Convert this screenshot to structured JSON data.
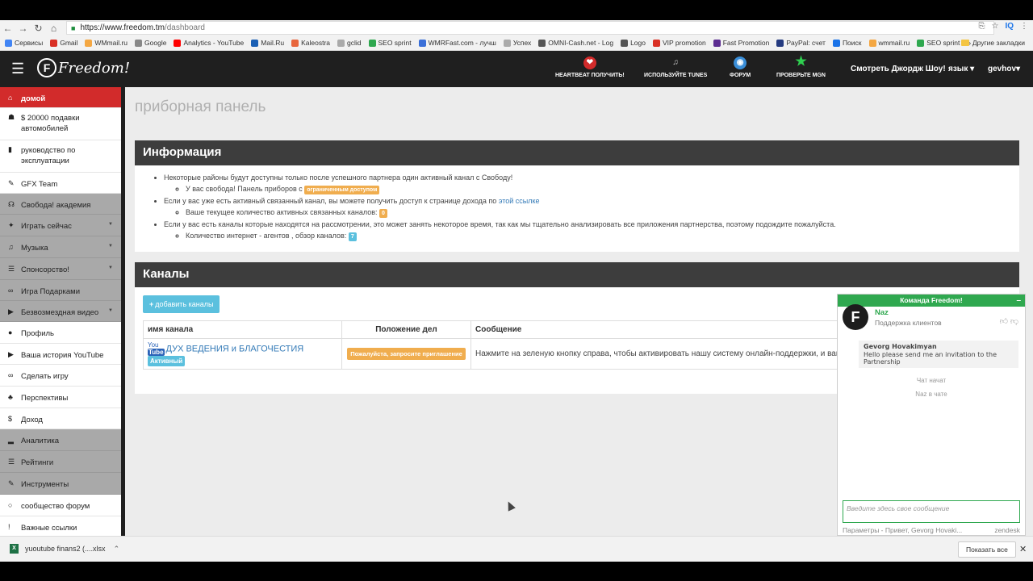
{
  "browser": {
    "url_host": "https://www.freedom.tm",
    "url_path": "/dashboard",
    "ext_label": "IQ",
    "bookmarks": [
      {
        "label": "Сервисы",
        "color": "#4285f4"
      },
      {
        "label": "Gmail",
        "color": "#d93025"
      },
      {
        "label": "WMmail.ru",
        "color": "#f4a742"
      },
      {
        "label": "Google",
        "color": "#888888"
      },
      {
        "label": "Analytics - YouTube",
        "color": "#ff0000"
      },
      {
        "label": "Mail.Ru",
        "color": "#1a5fb4"
      },
      {
        "label": "Kaleostra",
        "color": "#e8663d"
      },
      {
        "label": "gclid",
        "color": "#aaaaaa"
      },
      {
        "label": "SEO sprint",
        "color": "#2fa84f"
      },
      {
        "label": "WMRFast.com - лучш",
        "color": "#3a6fd8"
      },
      {
        "label": "Успех",
        "color": "#aaaaaa"
      },
      {
        "label": "OMNI-Cash.net - Log",
        "color": "#555555"
      },
      {
        "label": "Logo",
        "color": "#555555"
      },
      {
        "label": "VIP promotion",
        "color": "#d93025"
      },
      {
        "label": "Fast Promotion",
        "color": "#5c2d91"
      },
      {
        "label": "PayPal: счет",
        "color": "#253b80"
      },
      {
        "label": "Поиск",
        "color": "#1a73e8"
      },
      {
        "label": "wmmail.ru",
        "color": "#f4a742"
      },
      {
        "label": "SEO sprint",
        "color": "#2fa84f"
      }
    ],
    "bookmarks_more": "»",
    "other_bookmarks": "Другие закладки"
  },
  "header": {
    "logo_letter": "F",
    "logo_text": "Freedom!",
    "items": [
      {
        "label": "HEARTBEAT ПОЛУЧИТЬ!",
        "icon": "heart-icon",
        "color": "#d22b2b",
        "glyph": "❤"
      },
      {
        "label": "ИСПОЛЬЗУЙТЕ TUNES",
        "icon": "tunes-icon",
        "color": "#1f1f1f",
        "glyph": "♫"
      },
      {
        "label": "ФОРУМ",
        "icon": "forum-icon",
        "color": "#3a8ed8",
        "glyph": "◉"
      },
      {
        "label": "ПРОВЕРЬТЕ MGN",
        "icon": "star-icon",
        "color": "#1f1f1f",
        "glyph": "★"
      }
    ],
    "watch": "Смотреть Джордж Шоу!",
    "language": "язык",
    "user": "gevhov"
  },
  "sidebar": {
    "items": [
      {
        "label": "домой",
        "icon": "home-icon",
        "glyph": "⌂",
        "style": "active",
        "h": 26,
        "arrow": false
      },
      {
        "label": "$ 20000 подавки автомобилей",
        "icon": "car-icon",
        "glyph": "☗",
        "style": "white",
        "h": 40,
        "arrow": false
      },
      {
        "label": "руководство по эксплуатации",
        "icon": "book-icon",
        "glyph": "▮",
        "style": "white",
        "h": 40,
        "arrow": false
      },
      {
        "label": "GFX Team",
        "icon": "brush-icon",
        "glyph": "✎",
        "style": "white",
        "h": 26,
        "arrow": false
      },
      {
        "label": "Свобода! академия",
        "icon": "academy-icon",
        "glyph": "☊",
        "style": "gray",
        "h": 26,
        "arrow": false
      },
      {
        "label": "Играть сейчас",
        "icon": "gamepad-icon",
        "glyph": "✦",
        "style": "gray",
        "h": 27,
        "arrow": true
      },
      {
        "label": "Музыка",
        "icon": "music-icon",
        "glyph": "♫",
        "style": "gray",
        "h": 27,
        "arrow": true
      },
      {
        "label": "Спонсорство!",
        "icon": "list-icon",
        "glyph": "☰",
        "style": "gray",
        "h": 27,
        "arrow": true
      },
      {
        "label": "Игра Подарками",
        "icon": "gift-icon",
        "glyph": "∞",
        "style": "gray",
        "h": 26,
        "arrow": false
      },
      {
        "label": "Безвозмездная видео",
        "icon": "play-icon",
        "glyph": "▶",
        "style": "gray",
        "h": 26,
        "arrow": true
      },
      {
        "label": "Профиль",
        "icon": "user-icon",
        "glyph": "●",
        "style": "white",
        "h": 27,
        "arrow": false
      },
      {
        "label": "Ваша история YouTube",
        "icon": "play-small-icon",
        "glyph": "▶",
        "style": "white",
        "h": 26,
        "arrow": false
      },
      {
        "label": "Сделать игру",
        "icon": "gamepad2-icon",
        "glyph": "∞",
        "style": "white",
        "h": 27,
        "arrow": false
      },
      {
        "label": "Перспективы",
        "icon": "group-icon",
        "glyph": "♣",
        "style": "white",
        "h": 27,
        "arrow": false
      },
      {
        "label": "Доход",
        "icon": "dollar-icon",
        "glyph": "$",
        "style": "white",
        "h": 26,
        "arrow": false
      },
      {
        "label": "Аналитика",
        "icon": "chart-icon",
        "glyph": "▂",
        "style": "gray",
        "h": 27,
        "arrow": false
      },
      {
        "label": "Рейтинги",
        "icon": "list2-icon",
        "glyph": "☰",
        "style": "gray",
        "h": 27,
        "arrow": false
      },
      {
        "label": "Инструменты",
        "icon": "wrench-icon",
        "glyph": "✎",
        "style": "gray",
        "h": 27,
        "arrow": false
      },
      {
        "label": "сообщество форум",
        "icon": "comment-icon",
        "glyph": "○",
        "style": "white",
        "h": 27,
        "arrow": false
      },
      {
        "label": "Важные ссылки",
        "icon": "exclaim-icon",
        "glyph": "!",
        "style": "white",
        "h": 26,
        "arrow": false
      }
    ]
  },
  "main": {
    "page_title": "приборная панель",
    "info": {
      "title": "Информация",
      "line1": "Некоторые районы будут доступны только после успешного партнера один активный канал с Свободу!",
      "line1_sub": "У вас свобода! Панель приборов с",
      "line1_badge": "ограниченным доступом",
      "line2": "Если у вас уже есть активный связанный канал, вы можете получить доступ к странице дохода по",
      "line2_link": "этой ссылке",
      "line2_sub": "Ваше текущее количество активных связанных каналов:",
      "line2_badge": "0",
      "line3": "Если у вас есть каналы которые находятся на рассмотрении, это может занять некоторое время, так как мы тщательно анализировать все приложения партнерства, поэтому подождите пожалуйста.",
      "line3_sub": "Количество интернет - агентов , обзор каналов:",
      "line3_badge": "7"
    },
    "channels": {
      "title": "Каналы",
      "add_button": "добавить каналы",
      "columns": [
        "имя канала",
        "Положение дел",
        "Сообщение"
      ],
      "row": {
        "yt_top": "You",
        "yt_bottom": "Tube",
        "name": "ДУХ ВЕДЕНИЯ и БЛАГОЧЕСТИЯ",
        "active_badge": "Активный",
        "status_badge": "Пожалуйста, запросите приглашение",
        "message": "Нажмите на зеленую кнопку справа, чтобы активировать нашу систему онлайн-поддержки, и вам пройти через наш процесс приглашения."
      }
    }
  },
  "chat": {
    "title": "Команда Freedom!",
    "minimize": "–",
    "avatar_letter": "F",
    "agent_name": "Naz",
    "agent_role": "Поддержка клиентов",
    "msg_author": "Gevorg Hovakimyan",
    "msg_text": "Hello please send me an invitation to the Partnership",
    "status1": "Чат начат",
    "status2": "Naz в чате",
    "input_placeholder": "Введите здесь свое сообщение",
    "footer_left": "Параметры - Привет, Gevorg Hovaki...",
    "footer_right": "zendesk"
  },
  "downloads": {
    "file": "yuoutube finans2 (....xlsx",
    "show_all": "Показать все",
    "close": "✕"
  }
}
